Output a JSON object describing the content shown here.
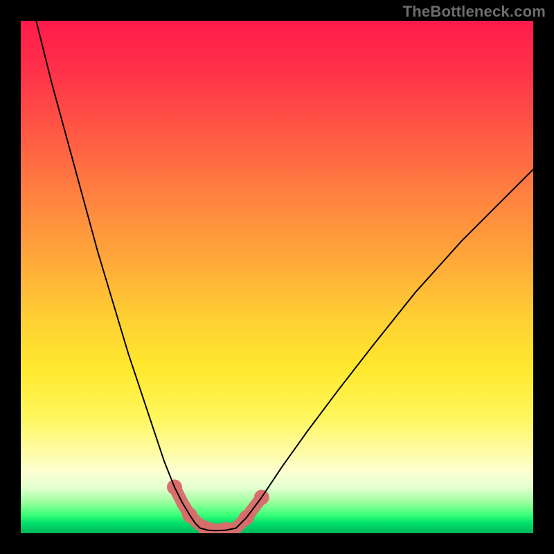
{
  "watermark": "TheBottleneck.com",
  "colors": {
    "background": "#000000",
    "curve": "#000000",
    "marker": "#d96b6b",
    "gradient_top": "#ff1b4b",
    "gradient_bottom": "#00b75c"
  },
  "chart_data": {
    "type": "line",
    "title": "",
    "xlabel": "",
    "ylabel": "",
    "xlim": [
      0,
      100
    ],
    "ylim": [
      0,
      100
    ],
    "background": "rainbow-vertical-gradient",
    "series": [
      {
        "name": "left-curve",
        "x": [
          3,
          6,
          9,
          12,
          15,
          18,
          21,
          24,
          26,
          28,
          30,
          31.5,
          33,
          34,
          35
        ],
        "y": [
          100,
          88,
          77,
          66,
          55,
          45,
          35,
          26,
          20,
          14,
          9,
          6,
          3.5,
          2,
          1
        ]
      },
      {
        "name": "valley-floor",
        "x": [
          35,
          36.5,
          38,
          40,
          42
        ],
        "y": [
          1,
          0.6,
          0.5,
          0.6,
          1
        ]
      },
      {
        "name": "right-curve",
        "x": [
          42,
          44,
          47,
          51,
          56,
          62,
          69,
          77,
          86,
          95,
          100
        ],
        "y": [
          1,
          3,
          7,
          13,
          20,
          28,
          37,
          47,
          57,
          66,
          71
        ]
      }
    ],
    "markers": {
      "name": "valley-highlight",
      "color": "#d96b6b",
      "points_x": [
        30,
        31.5,
        33,
        34.5,
        36,
        38,
        40,
        42,
        44,
        45.5,
        47
      ],
      "points_y": [
        9,
        6,
        3.5,
        2,
        1,
        0.7,
        0.7,
        1,
        3,
        5,
        7
      ]
    }
  }
}
